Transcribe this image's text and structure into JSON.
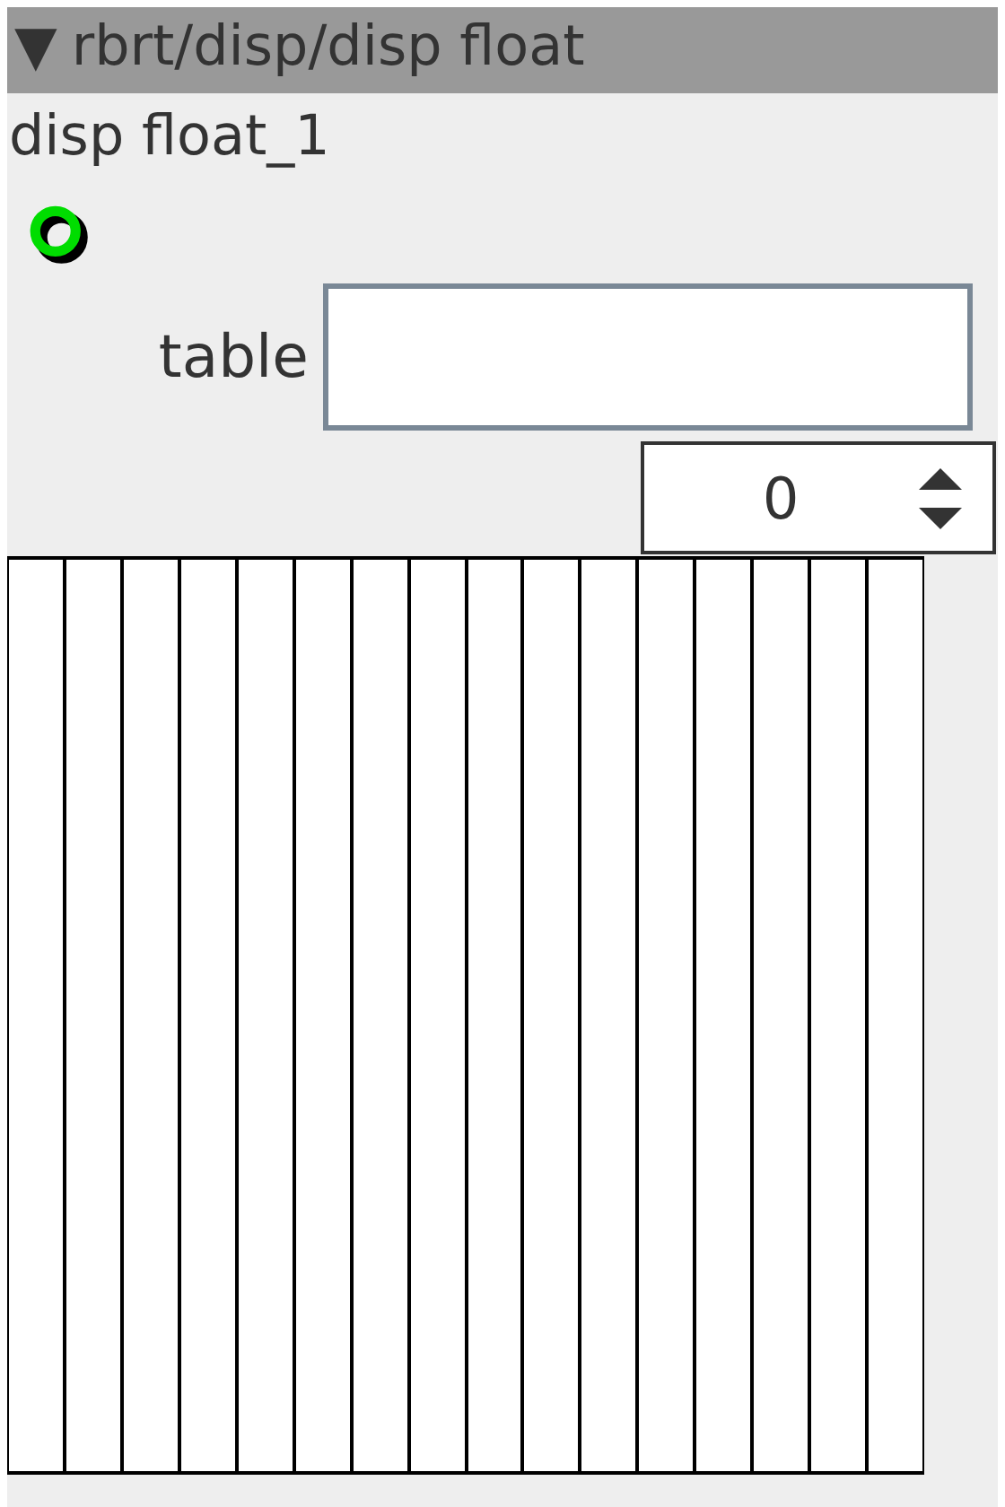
{
  "header": {
    "toggle": "▼",
    "title": "rbrt/disp/disp float"
  },
  "name": "disp float_1",
  "status": {
    "on": true
  },
  "table_field": {
    "label": "table"
  },
  "index_spinner": {
    "value": "0"
  },
  "bars": [
    {
      "level": 1
    },
    {
      "level": 1
    },
    {
      "level": 1
    },
    {
      "level": 1
    },
    {
      "level": 1
    },
    {
      "level": 1
    },
    {
      "level": 1
    },
    {
      "level": 1
    },
    {
      "level": 1
    },
    {
      "level": 1
    },
    {
      "level": 1
    },
    {
      "level": 1
    },
    {
      "level": 1
    },
    {
      "level": 1
    },
    {
      "level": 1
    },
    {
      "level": 1
    }
  ]
}
